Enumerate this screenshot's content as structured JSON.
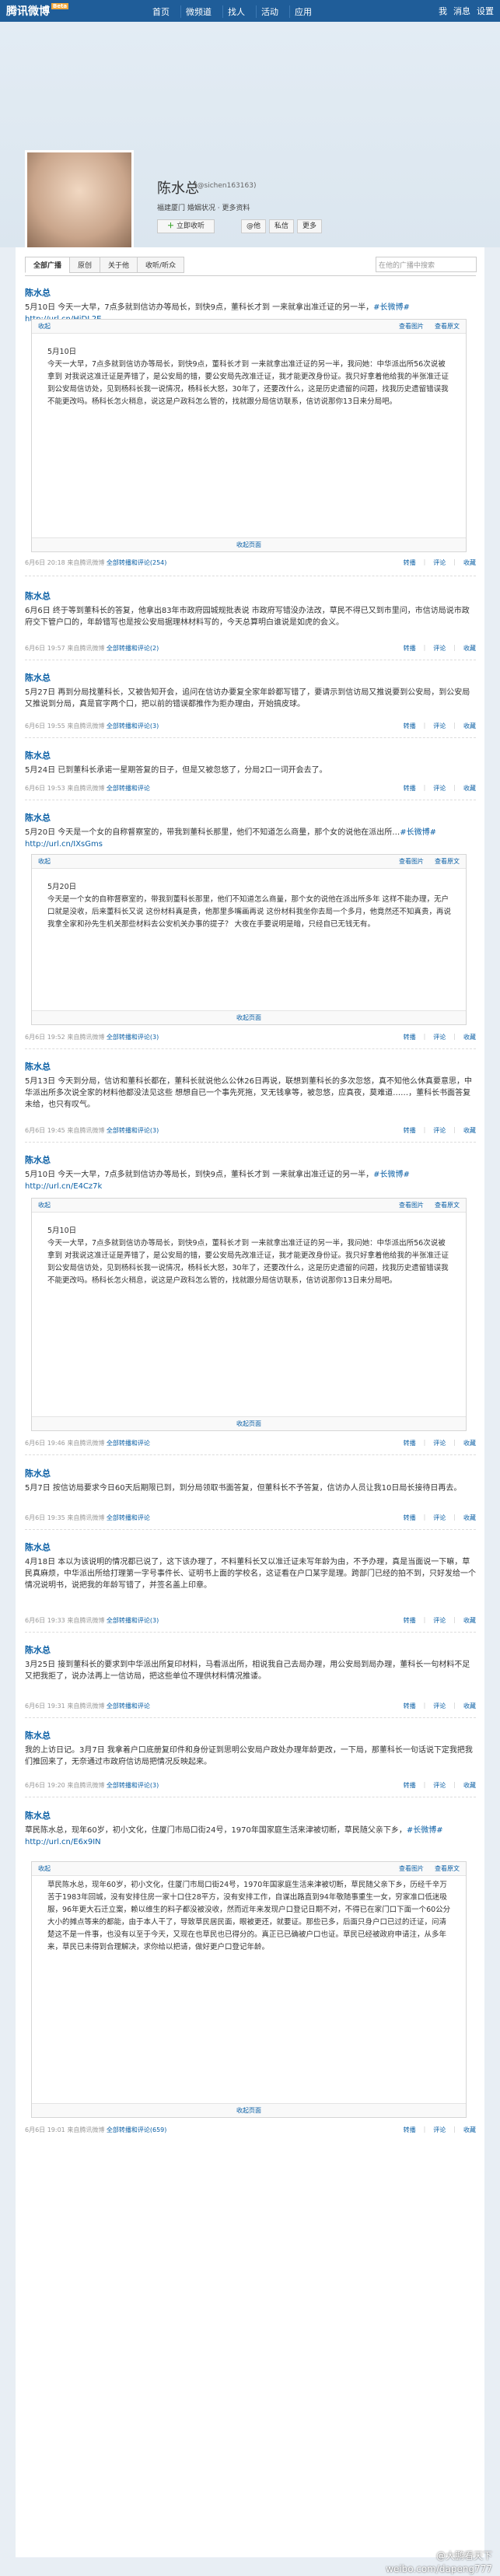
{
  "nav": {
    "logo": "腾讯微博",
    "badge": "Beta",
    "items": [
      "首页",
      "微频道",
      "找人",
      "活动",
      "应用"
    ],
    "icons": [
      "我",
      "消息",
      "设置"
    ]
  },
  "profile": {
    "name": "陈水总",
    "id": "(@sichen163163)",
    "location": "福建厦门 婚姻状况 · 更多资料",
    "follow_label": "立即收听",
    "actions": [
      "@他",
      "私信",
      "更多"
    ]
  },
  "tabs": [
    "全部广播",
    "原创",
    "关于他",
    "收听/听众"
  ],
  "search_placeholder": "在他的广播中搜索",
  "posts": [
    {
      "author": "陈水总",
      "text": "5月10日 今天一大早，7点多就到信访办等局长，到快9点，董科长才到 一来就拿出准迁证的另一半，",
      "link": "#长微博# http://url.cn/HjDL2E",
      "expand_text": "5月10日\n今天一大早，7点多就到信访办等局长，到快9点，董科长才到 一来就拿出准迁证的另一半，我问她：中华派出所56次说被拿到 对我说这准迁证是弄错了，是公安局的错，要公安局先改准迁证，我才能更改身份证。我只好拿着他给我的半张准迁证到公安局信访处，见到杨科长我一说情况，杨科长大怒，30年了，还要改什么，这是历史遗留的问题，找我历史遗留错误我不能更改吗。杨科长怎火稍息，说这是户政科怎么管的，找就跟分局信访联系，信访说那你13日来分局吧。",
      "meta": "6月6日 20:18 来自腾讯微博",
      "count": "全部转播和评论(254)"
    },
    {
      "author": "陈水总",
      "text": "6月6日 终于等到董科长的答复，他拿出83年市政府园城规批表说 市政府写错没办法改，草民不得已又到市里问，市信访局说市政府交下管户口的，年龄错写也是按公安局据理林材料写的，今天总算明白谁说是如虎的会义。",
      "meta": "6月6日 19:57 来自腾讯微博",
      "count": "全部转播和评论(2)"
    },
    {
      "author": "陈水总",
      "text": "5月27日 再到分局找董科长，又被告知开会，追问在信访办要复全家年龄都写错了，要请示到信访局又推说要到公安局，到公安局又推说到分局，真是官字两个口，把以前的错误都推作为拒办理由，开始搞皮球。",
      "meta": "6月6日 19:55 来自腾讯微博",
      "count": "全部转播和评论(3)"
    },
    {
      "author": "陈水总",
      "text": "5月24日 已到董科长承诺一星期答复的日子，但是又被忽悠了，分局2口一词开会去了。",
      "meta": "6月6日 19:53 来自腾讯微博",
      "count": "全部转播和评论"
    },
    {
      "author": "陈水总",
      "text": "5月20日 今天是一个女的自称督察室的，带我到董科长那里，他们不知道怎么商量，那个女的说他在派出所…",
      "link": "#长微博# http://url.cn/IXsGms",
      "expand_text": "5月20日\n今天是一个女的自称督察室的，带我到董科长那里，他们不知道怎么商量，那个女的说他在派出所多年 这样不能办理，无户口就是没收，后来董科长又说 这份材料真是贵，他那里多嘴画再说 这份材料我坐你去局一个多月，他竟然还不知真贵，再说我拿全家和孙先生机关那些材料去公安机关办事的提子？ 大夜在手要说明是暗，只经自已无钱无有。",
      "meta": "6月6日 19:52 来自腾讯微博",
      "count": "全部转播和评论(3)"
    },
    {
      "author": "陈水总",
      "text": "5月13日 今天到分局，信访和董科长都在，董科长就说他么公休26日再说，联想到董科长的多次忽悠，真不知他么休真要意思，中华派出所多次说全家的材料他都没法见这些 想想自已一个事先死拖，叉无钱拿等，被忽悠，应真夜，莫难道……，董科长书面答复未给，也只有叹气。",
      "meta": "6月6日 19:45 来自腾讯微博",
      "count": "全部转播和评论(3)"
    },
    {
      "author": "陈水总",
      "text": "5月10日 今天一大早，7点多就到信访办等局长，到快9点，董科长才到 一来就拿出准迁证的另一半，",
      "link": "#长微博# http://url.cn/E4Cz7k",
      "expand_text": "5月10日\n今天一大早，7点多就到信访办等局长，到快9点，董科长才到 一来就拿出准迁证的另一半，我问她：中华派出所56次说被拿到 对我说这准迁证是弄错了，是公安局的错，要公安局先改准迁证，我才能更改身份证。我只好拿着他给我的半张准迁证到公安局信访处，见到杨科长我一说情况，杨科长大怒，30年了，还要改什么，这是历史遗留的问题，找我历史遗留错误我不能更改吗。杨科长怎火稍息，说这是户政科怎么管的，找就跟分局信访联系，信访说那你13日来分局吧。",
      "meta": "6月6日 19:46 来自腾讯微博",
      "count": "全部转播和评论"
    },
    {
      "author": "陈水总",
      "text": "5月7日 按信访局要求今日60天后期限已到，到分局领取书面答复，但董科长不予答复，信访办人员让我10日局长接待日再去。",
      "meta": "6月6日 19:35 来自腾讯微博",
      "count": "全部转播和评论"
    },
    {
      "author": "陈水总",
      "text": "4月18日 本以为该说明的情况都已说了，这下该办理了，不料董科长又以准迁证未写年龄为由，不予办理，真是当面说一下嘛，草民真麻烦，中华派出所给打理第一字号事件长、证明书上面的学校名，这证看在户口某字是理。跨部门已经的拍不到，只好发给一个情况说明书，说把我的年龄写错了，并签名盖上印章。",
      "meta": "6月6日 19:33 来自腾讯微博",
      "count": "全部转播和评论(3)"
    },
    {
      "author": "陈水总",
      "text": "3月25日 接到董科长的要求到中华派出所复印材料，马看派出所，相说我自己去局办理，用公安局到局办理，董科长一句材料不足又把我拒了，说办法再上一信访局，把这些单位不理供材料情况推诿。",
      "meta": "6月6日 19:31 来自腾讯微博",
      "count": "全部转播和评论"
    },
    {
      "author": "陈水总",
      "text": "我的上访日记。3月7日 我拿着户口底册复印件和身份证到思明公安局户政处办理年龄更改，一下局，那董科长一句话说下定我把我们推回来了，无奈通过市政府信访局把情况反映起来。",
      "meta": "6月6日 19:20 来自腾讯微博",
      "count": "全部转播和评论(3)"
    },
    {
      "author": "陈水总",
      "text": "草民陈水总，现年60岁，初小文化，住厦门市局口街24号，1970年国家庭生活来津被切断，草民随父亲下乡，",
      "link": "#长微博# http://url.cn/E6x9IN",
      "expand_text": "草民陈水总，现年60岁，初小文化，住厦门市局口街24号，1970年国家庭生活来津被切断，草民随父亲下乡，历经千辛万苦于1983年回城，没有安排住房一家十口住28平方，没有安排工作，自谋出路直到94年敬随事重生一女，穷家准口低迷吸服，96年更大石迁立案，赖以维生的料子都没被没收，然而近年来发现户口登记日期不对，不得已在家门口下面一个60公分大小的摊点等来的都能，由于本人干了，导致草民居民面，眼被更还，就要证。那些已多，后面只身户口已过的迁证，问清楚这不是一件事，也没有以至于今天，又现在也草民也已得分的。真正已已确被户口也证。草民已经被政府申请注，从多年来，草民已未得到合理解决，求你给以把请，做好更户口登记年龄。",
      "meta": "6月6日 19:01 来自腾讯微博",
      "count": "全部转播和评论(659)"
    }
  ],
  "post_actions": [
    "转播",
    "评论",
    "收藏"
  ],
  "expand_labels": {
    "collapse": "收起",
    "view_image": "查看图片",
    "view_original": "查看原文",
    "collapse_footer": "收起页面"
  },
  "watermark": "@大鹏看天下",
  "watermark2": "weibo.com/dapeng777"
}
